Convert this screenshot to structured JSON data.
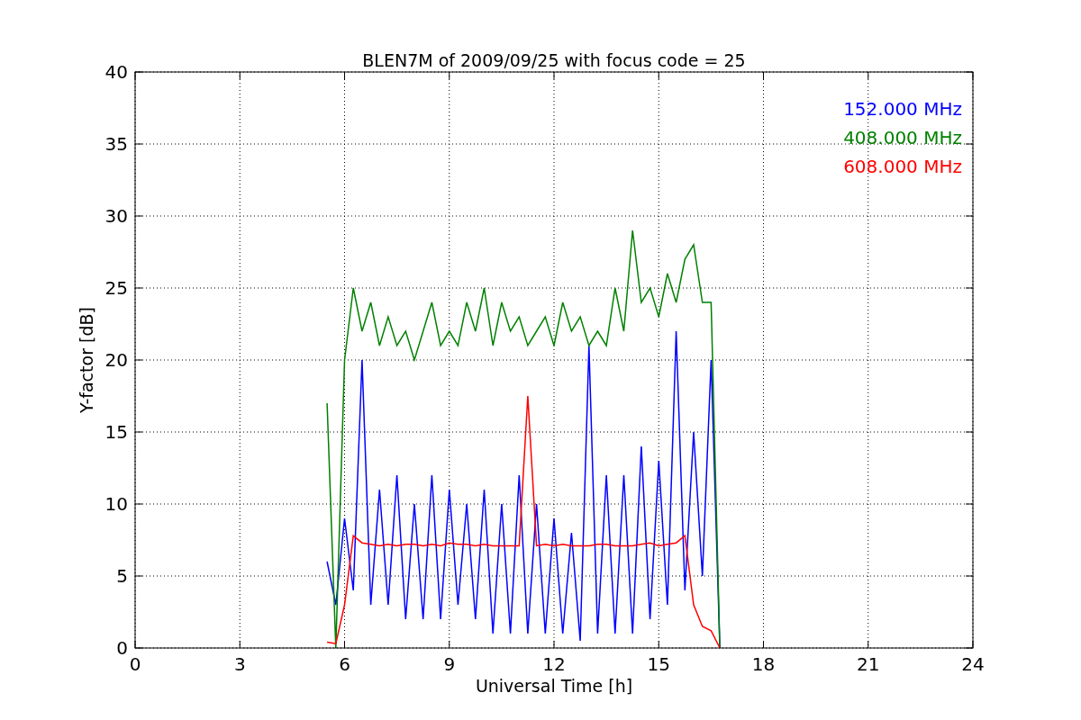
{
  "figure": {
    "chart_data": {
      "type": "line",
      "title": "BLEN7M of 2009/09/25 with focus code = 25",
      "xlabel": "Universal Time [h]",
      "ylabel": "Y-factor [dB]",
      "x": [
        5.5,
        5.75,
        6,
        6.25,
        6.5,
        6.75,
        7,
        7.25,
        7.5,
        7.75,
        8,
        8.25,
        8.5,
        8.75,
        9,
        9.25,
        9.5,
        9.75,
        10,
        10.25,
        10.5,
        10.75,
        11,
        11.25,
        11.5,
        11.75,
        12,
        12.25,
        12.5,
        12.75,
        13,
        13.25,
        13.5,
        13.75,
        14,
        14.25,
        14.5,
        14.75,
        15,
        15.25,
        15.5,
        15.75,
        16,
        16.25,
        16.5,
        16.75
      ],
      "series": [
        {
          "name": "152.000 MHz",
          "color": "#0000ff",
          "values": [
            6,
            3,
            9,
            4,
            20,
            3,
            11,
            3,
            12,
            2,
            10,
            2,
            12,
            2,
            11,
            3,
            10,
            2,
            11,
            1,
            10,
            1,
            12,
            1,
            10,
            1,
            9,
            1,
            8,
            0.5,
            21,
            1,
            12,
            1,
            12,
            1,
            14,
            2,
            13,
            3,
            22,
            4,
            15,
            5,
            20,
            0
          ]
        },
        {
          "name": "408.000 MHz",
          "color": "#008000",
          "values": [
            17,
            0,
            20,
            25,
            22,
            24,
            21,
            23,
            21,
            22,
            20,
            22,
            24,
            21,
            22,
            21,
            24,
            22,
            25,
            21,
            24,
            22,
            23,
            21,
            22,
            23,
            21,
            24,
            22,
            23,
            21,
            22,
            21,
            25,
            22,
            29,
            24,
            25,
            23,
            26,
            24,
            27,
            28,
            24,
            24,
            0
          ]
        },
        {
          "name": "608.000 MHz",
          "color": "#ff0000",
          "values": [
            0.4,
            0.3,
            3,
            7.8,
            7.3,
            7.2,
            7.1,
            7.2,
            7.1,
            7.2,
            7.2,
            7.1,
            7.2,
            7.1,
            7.3,
            7.2,
            7.2,
            7.1,
            7.2,
            7.1,
            7.1,
            7.1,
            7.1,
            17.5,
            7.1,
            7.2,
            7.1,
            7.2,
            7.1,
            7.1,
            7.1,
            7.2,
            7.2,
            7.1,
            7.1,
            7.1,
            7.2,
            7.3,
            7.1,
            7.2,
            7.3,
            7.8,
            3,
            1.5,
            1.2,
            0
          ]
        }
      ],
      "grid": true,
      "xlim": [
        0,
        24
      ],
      "ylim": [
        0,
        40
      ],
      "xticks": [
        0,
        3,
        6,
        9,
        12,
        15,
        18,
        21,
        24
      ],
      "yticks": [
        0,
        5,
        10,
        15,
        20,
        25,
        30,
        35,
        40
      ]
    }
  }
}
